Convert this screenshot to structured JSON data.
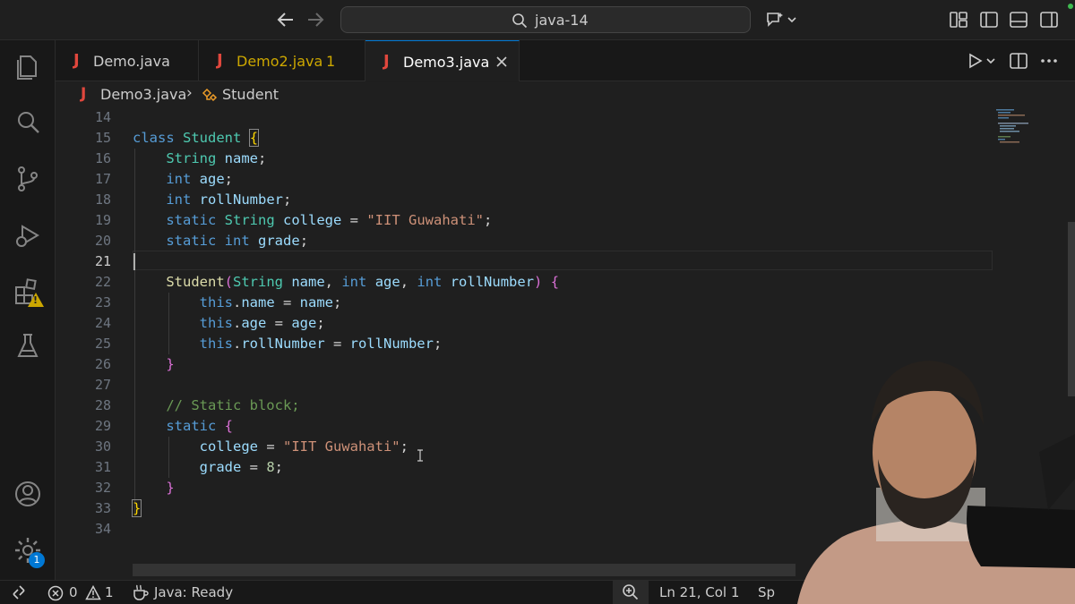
{
  "titlebar": {
    "search_text": "java-14"
  },
  "tabs": [
    {
      "icon": "J",
      "label": "Demo.java",
      "badge": ""
    },
    {
      "icon": "J",
      "label": "Demo2.java",
      "badge": "1"
    },
    {
      "icon": "J",
      "label": "Demo3.java",
      "badge": ""
    }
  ],
  "breadcrumb": {
    "file_icon": "J",
    "file": "Demo3.java",
    "sep": "›",
    "symbol": "Student"
  },
  "activity": {
    "extensions_warning": "!",
    "settings_badge": "1"
  },
  "editor": {
    "line_numbers": [
      "14",
      "15",
      "16",
      "17",
      "18",
      "19",
      "20",
      "21",
      "22",
      "23",
      "24",
      "25",
      "26",
      "27",
      "28",
      "29",
      "30",
      "31",
      "32",
      "33",
      "34"
    ],
    "current_line": "21",
    "tokens": {
      "class_kw": "class",
      "class_name": "Student",
      "string_type": "String",
      "int_type": "int",
      "static_kw": "static",
      "this_kw": "this",
      "field_name": "name",
      "field_age": "age",
      "field_roll": "rollNumber",
      "field_college": "college",
      "field_grade": "grade",
      "college_value": "\"IIT Guwahati\"",
      "grade_value": "8",
      "comment": "// Static block;",
      "open_brace": "{",
      "close_brace": "}",
      "open_paren": "(",
      "close_paren": ")",
      "semi": ";",
      "eq": " = ",
      "comma": ", ",
      "dot": "."
    }
  },
  "statusbar": {
    "errors": "0",
    "warnings": "1",
    "java_status": "Java: Ready",
    "position": "Ln 21, Col 1",
    "spaces": "Sp"
  },
  "colors": {
    "accent": "#0078d4",
    "java_icon": "#e0473d",
    "modified_tab": "#cca700"
  }
}
